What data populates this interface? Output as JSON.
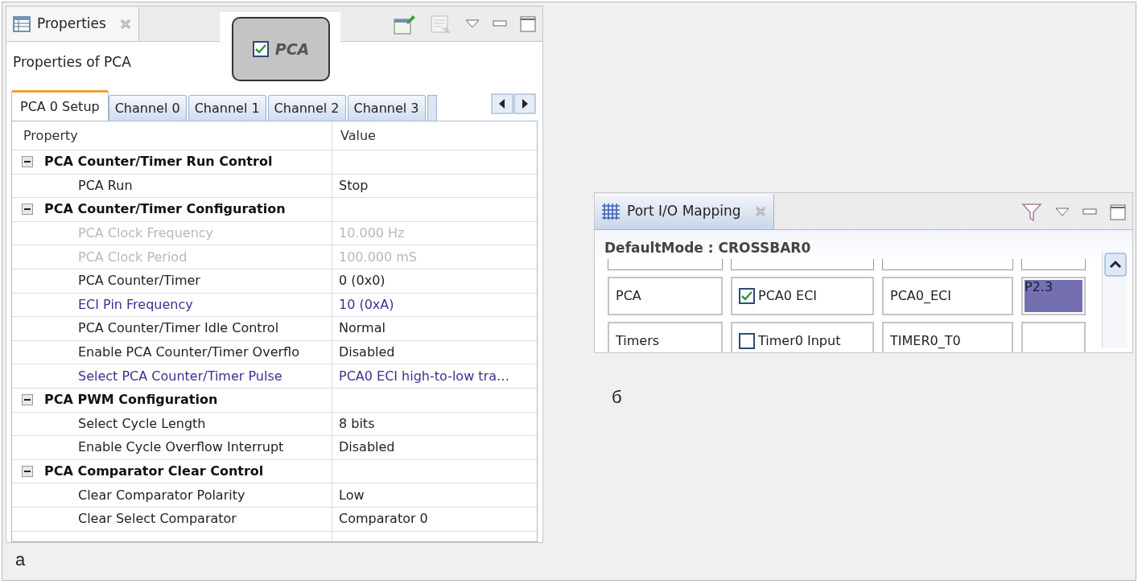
{
  "properties_view": {
    "title": "Properties",
    "subtitle": "Properties of PCA",
    "component_chip": {
      "label": "PCA",
      "checked": true
    },
    "tabs": [
      {
        "label": "PCA 0 Setup",
        "selected": true
      },
      {
        "label": "Channel 0",
        "selected": false
      },
      {
        "label": "Channel 1",
        "selected": false
      },
      {
        "label": "Channel 2",
        "selected": false
      },
      {
        "label": "Channel 3",
        "selected": false
      }
    ],
    "columns": [
      "Property",
      "Value"
    ],
    "rows": [
      {
        "kind": "group",
        "label": "PCA Counter/Timer Run Control",
        "expanded": true
      },
      {
        "kind": "property",
        "label": "PCA Run",
        "value": "Stop",
        "disabled": false,
        "changed": false
      },
      {
        "kind": "group",
        "label": "PCA Counter/Timer Configuration",
        "expanded": true
      },
      {
        "kind": "property",
        "label": "PCA Clock Frequency",
        "value": "10.000 Hz",
        "disabled": true,
        "changed": false
      },
      {
        "kind": "property",
        "label": "PCA Clock Period",
        "value": "100.000 mS",
        "disabled": true,
        "changed": false
      },
      {
        "kind": "property",
        "label": "PCA Counter/Timer",
        "value": "0 (0x0)",
        "disabled": false,
        "changed": false
      },
      {
        "kind": "property",
        "label": "ECI Pin Frequency",
        "value": "10 (0xA)",
        "disabled": false,
        "changed": true
      },
      {
        "kind": "property",
        "label": "PCA Counter/Timer Idle Control",
        "value": "Normal",
        "disabled": false,
        "changed": false
      },
      {
        "kind": "property",
        "label": "Enable PCA Counter/Timer Overflo",
        "value": "Disabled",
        "disabled": false,
        "changed": false
      },
      {
        "kind": "property",
        "label": "Select PCA Counter/Timer Pulse",
        "value": "PCA0 ECI high-to-low tra…",
        "disabled": false,
        "changed": true
      },
      {
        "kind": "group",
        "label": "PCA PWM Configuration",
        "expanded": true
      },
      {
        "kind": "property",
        "label": "Select Cycle Length",
        "value": "8 bits",
        "disabled": false,
        "changed": false
      },
      {
        "kind": "property",
        "label": "Enable Cycle Overflow Interrupt",
        "value": "Disabled",
        "disabled": false,
        "changed": false
      },
      {
        "kind": "group",
        "label": "PCA Comparator Clear Control",
        "expanded": true
      },
      {
        "kind": "property",
        "label": "Clear Comparator Polarity",
        "value": "Low",
        "disabled": false,
        "changed": false
      },
      {
        "kind": "property",
        "label": "Clear Select Comparator",
        "value": "Comparator 0",
        "disabled": false,
        "changed": false
      }
    ],
    "caption": "а"
  },
  "port_io_view": {
    "title": "Port I/O Mapping",
    "heading": "DefaultMode : CROSSBAR0",
    "rows": [
      {
        "peripheral": "PCA",
        "signal": "PCA0 ECI",
        "checked": true,
        "name": "PCA0_ECI",
        "pin": "P2.3",
        "selected": true
      },
      {
        "peripheral": "Timers",
        "signal": "Timer0 Input",
        "checked": false,
        "name": "TIMER0_T0",
        "selected": false
      }
    ],
    "caption": "б"
  }
}
